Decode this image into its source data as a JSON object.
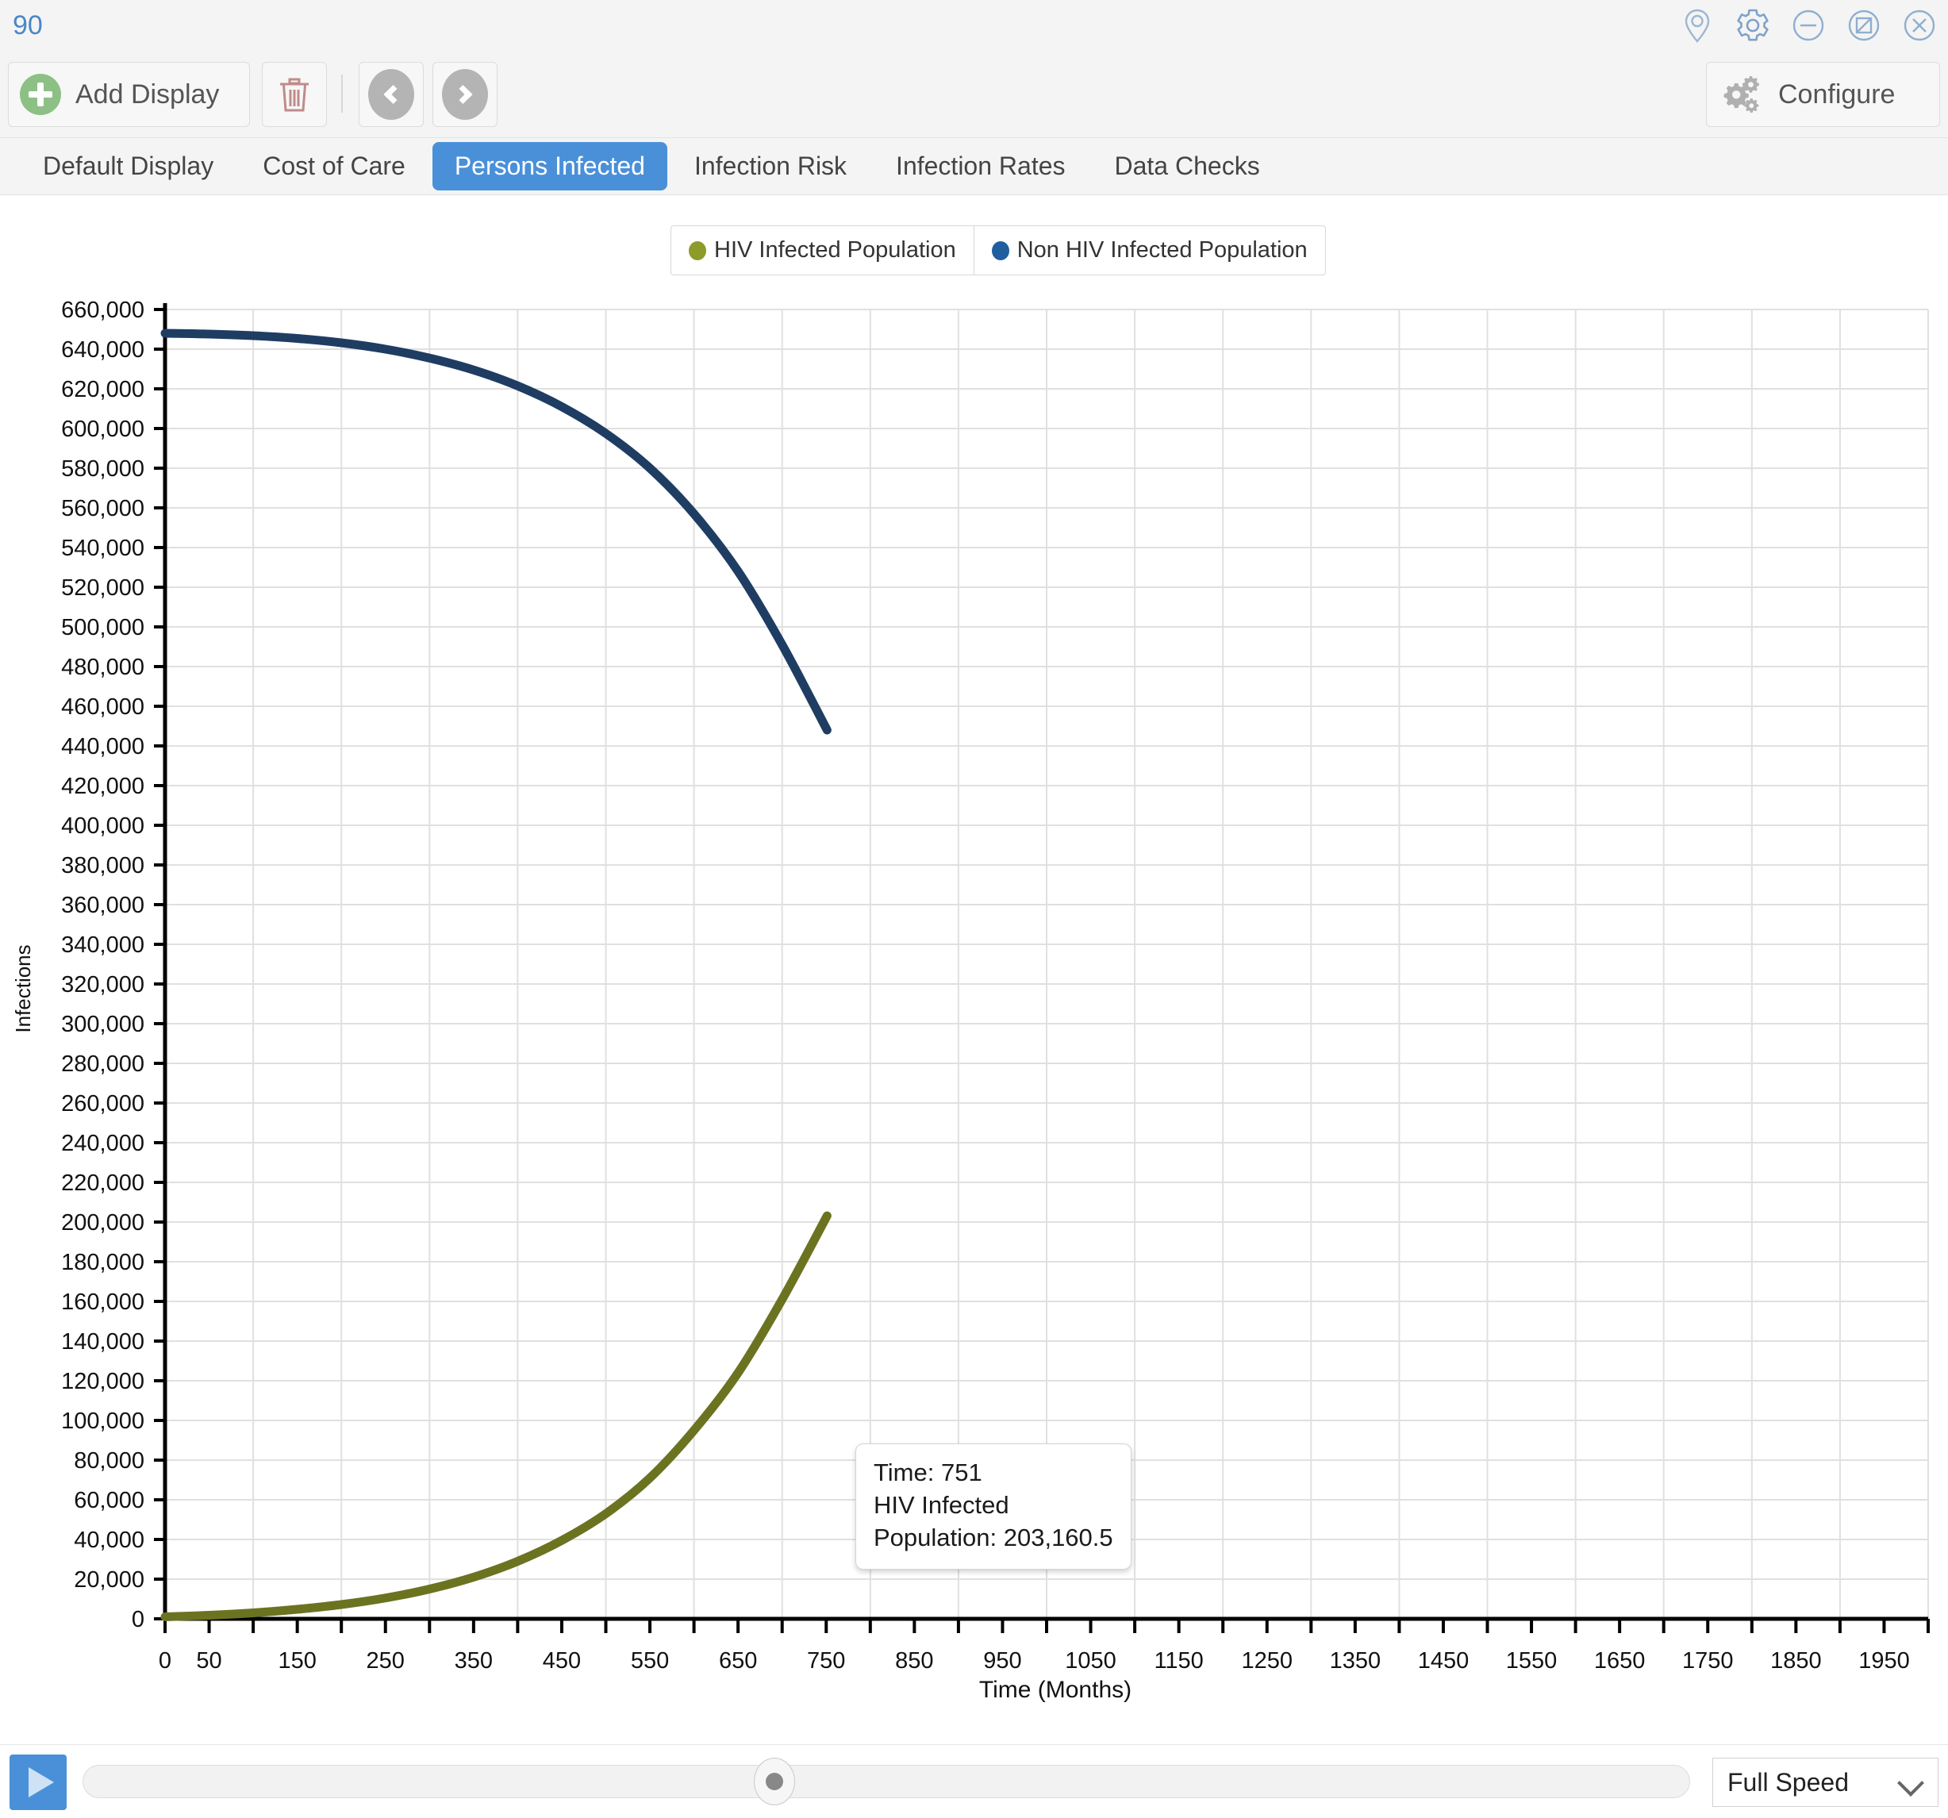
{
  "window": {
    "number": "90",
    "icons": [
      "location-pin-icon",
      "gear-icon",
      "minimize-icon",
      "restore-disabled-icon",
      "close-icon"
    ]
  },
  "toolbar": {
    "add_display_label": "Add Display",
    "delete_icon": "trash-icon",
    "prev_icon": "chevron-left-icon",
    "next_icon": "chevron-right-icon",
    "edit_icon": "pencil-icon",
    "configure_label": "Configure",
    "configure_icon": "gears-icon"
  },
  "tabs": [
    {
      "label": "Default Display",
      "active": false
    },
    {
      "label": "Cost of Care",
      "active": false
    },
    {
      "label": "Persons Infected",
      "active": true
    },
    {
      "label": "Infection Risk",
      "active": false
    },
    {
      "label": "Infection Rates",
      "active": false
    },
    {
      "label": "Data Checks",
      "active": false
    }
  ],
  "tooltip": {
    "time_line": "Time: 751",
    "series_line": "HIV Infected",
    "value_line": "Population: 203,160.5"
  },
  "player": {
    "play_icon": "play-icon",
    "speed_value": "Full Speed",
    "speed_options": [
      "Full Speed"
    ],
    "slider_position_pct": 37
  },
  "colors": {
    "accent": "#4a90d9",
    "hiv_series": "#6b7320",
    "non_hiv_series": "#1f3d63",
    "add_green": "#8cc084",
    "trash_red": "#c08b8b"
  },
  "chart_data": {
    "type": "line",
    "title": "",
    "xlabel": "Time (Months)",
    "ylabel": "Infections",
    "xlim": [
      0,
      2000
    ],
    "ylim": [
      0,
      660000
    ],
    "grid": true,
    "legend_position": "top-center",
    "x_major_step": 100,
    "x_minor_step": 50,
    "y_step": 20000,
    "xticks": [
      0,
      50,
      150,
      250,
      350,
      450,
      550,
      650,
      750,
      850,
      950,
      1050,
      1150,
      1250,
      1350,
      1450,
      1550,
      1650,
      1750,
      1850,
      1950
    ],
    "yticks": [
      0,
      20000,
      40000,
      60000,
      80000,
      100000,
      120000,
      140000,
      160000,
      180000,
      200000,
      220000,
      240000,
      260000,
      280000,
      300000,
      320000,
      340000,
      360000,
      380000,
      400000,
      420000,
      440000,
      460000,
      480000,
      500000,
      520000,
      540000,
      560000,
      580000,
      600000,
      620000,
      640000,
      660000
    ],
    "ytick_labels": [
      "0",
      "20,000",
      "40,000",
      "60,000",
      "80,000",
      "100,000",
      "120,000",
      "140,000",
      "160,000",
      "180,000",
      "200,000",
      "220,000",
      "240,000",
      "260,000",
      "280,000",
      "300,000",
      "320,000",
      "340,000",
      "360,000",
      "380,000",
      "400,000",
      "420,000",
      "440,000",
      "460,000",
      "480,000",
      "500,000",
      "520,000",
      "540,000",
      "560,000",
      "580,000",
      "600,000",
      "620,000",
      "640,000",
      "660,000"
    ],
    "series": [
      {
        "name": "HIV Infected Population",
        "color": "#6b7320",
        "x": [
          0,
          50,
          100,
          150,
          200,
          250,
          300,
          350,
          400,
          450,
          500,
          550,
          600,
          650,
          700,
          751
        ],
        "values": [
          1000,
          1800,
          3000,
          4800,
          7200,
          10500,
          15000,
          21000,
          29000,
          39500,
          53000,
          71000,
          95000,
          124000,
          161000,
          203160.5
        ]
      },
      {
        "name": "Non HIV Infected Population",
        "color": "#1f3d63",
        "x": [
          0,
          50,
          100,
          150,
          200,
          250,
          300,
          350,
          400,
          450,
          500,
          550,
          600,
          650,
          700,
          751
        ],
        "values": [
          648000,
          647600,
          646800,
          645400,
          643200,
          640000,
          635500,
          629500,
          621500,
          611000,
          597500,
          580000,
          557000,
          528000,
          491000,
          448000
        ]
      }
    ],
    "annotation": {
      "x": 751,
      "y": 203160.5,
      "series": "HIV Infected Population",
      "text": "Time: 751 / HIV Infected Population: 203,160.5"
    }
  }
}
